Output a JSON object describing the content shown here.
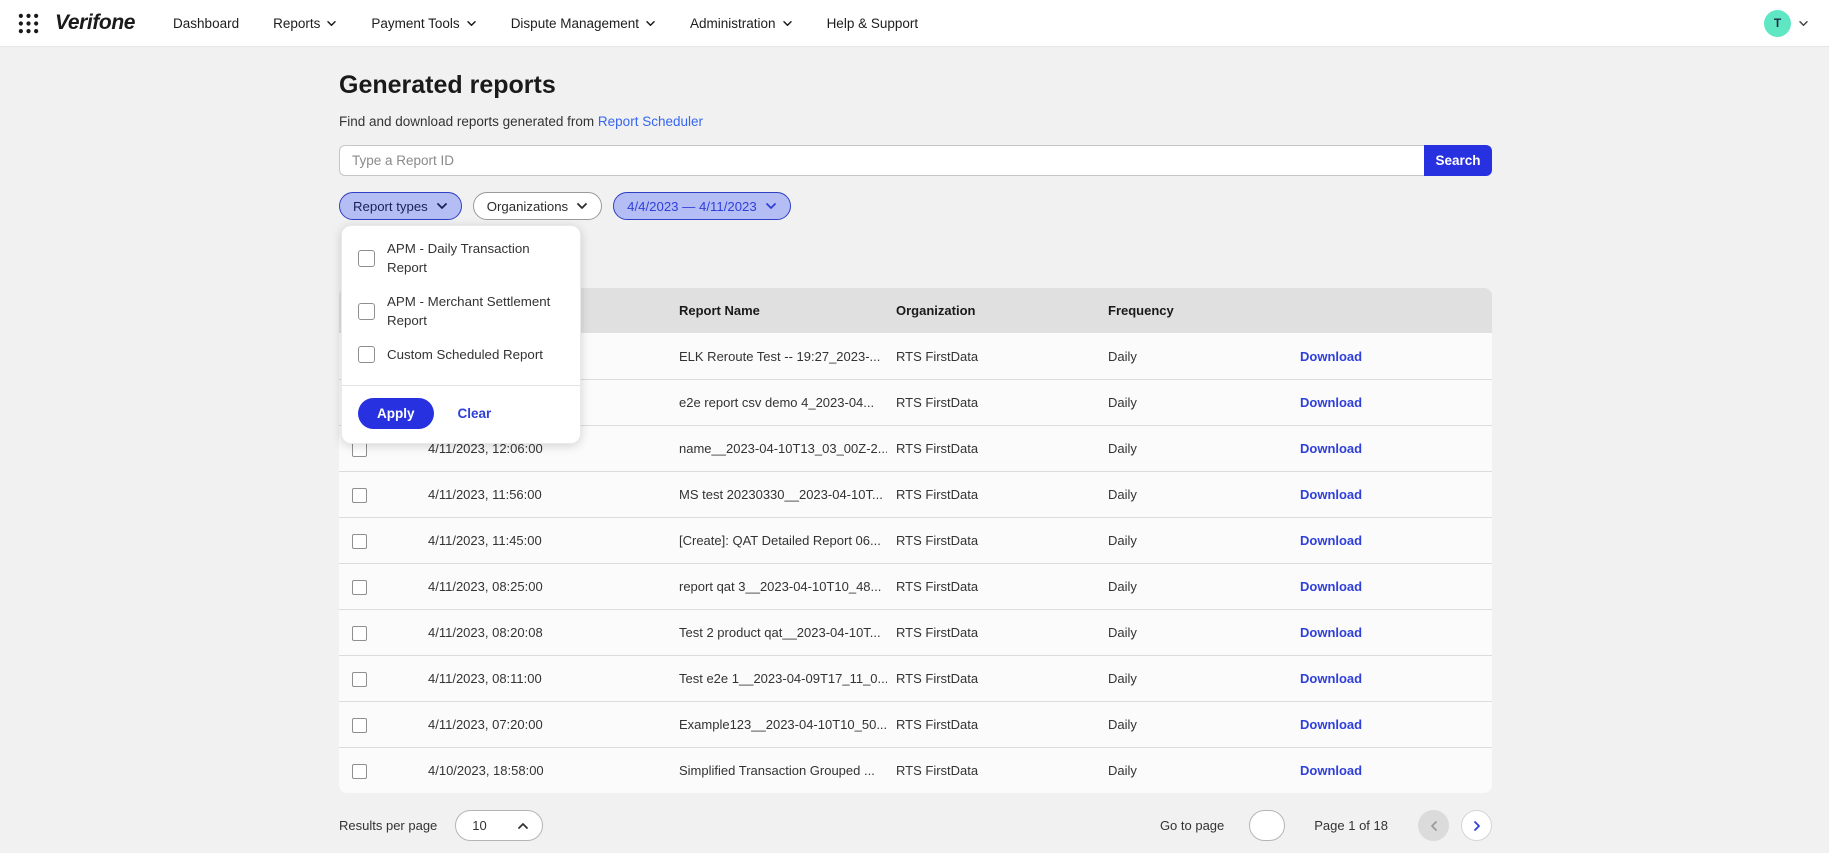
{
  "colors": {
    "accent": "#2731E0",
    "action-blue": "#2F3FD9",
    "link-blue": "#3566EF",
    "chip-bg": "#B5BEF4",
    "chip-border": "#2E3FC2",
    "chip-text": "#17215C",
    "avatar-bg": "#5FE7C3",
    "table-header-bg": "#E0E0E1",
    "page-bg": "#F1F1F2",
    "row-bg": "#FBFBFB",
    "border": "#DCDCDC",
    "text-dark": "#1A1A1A",
    "text-body": "#333333"
  },
  "nav": {
    "brand": "Verifone",
    "items": [
      {
        "label": "Dashboard",
        "has_dropdown": false
      },
      {
        "label": "Reports",
        "has_dropdown": true
      },
      {
        "label": "Payment Tools",
        "has_dropdown": true
      },
      {
        "label": "Dispute Management",
        "has_dropdown": true
      },
      {
        "label": "Administration",
        "has_dropdown": true
      },
      {
        "label": "Help & Support",
        "has_dropdown": false
      }
    ],
    "avatar_initial": "T"
  },
  "header": {
    "title": "Generated reports",
    "subtitle": "Find and download reports generated from",
    "subtitle_link": "Report Scheduler"
  },
  "search": {
    "placeholder": "Type a Report ID",
    "button": "Search"
  },
  "filters": {
    "chips": [
      {
        "label": "Report types",
        "state": "selected"
      },
      {
        "label": "Organizations",
        "state": "neutral"
      },
      {
        "label": "4/4/2023 — 4/11/2023",
        "state": "date"
      }
    ]
  },
  "dropdown": {
    "options": [
      "APM - Daily Transaction Report",
      "APM - Merchant Settlement Report",
      "Custom Scheduled Report"
    ],
    "apply_label": "Apply",
    "clear_label": "Clear"
  },
  "table": {
    "visible_headers": {
      "report_name": "Report Name",
      "organization": "Organization",
      "frequency": "Frequency"
    },
    "rows": [
      {
        "date": "",
        "name": "ELK Reroute Test -- 19:27_2023-...",
        "org": "RTS FirstData",
        "frequency": "Daily",
        "action": "Download"
      },
      {
        "date": "",
        "name": "e2e report csv demo 4_2023-04...",
        "org": "RTS FirstData",
        "frequency": "Daily",
        "action": "Download"
      },
      {
        "date": "4/11/2023, 12:06:00",
        "name": "name__2023-04-10T13_03_00Z-2...",
        "org": "RTS FirstData",
        "frequency": "Daily",
        "action": "Download"
      },
      {
        "date": "4/11/2023, 11:56:00",
        "name": "MS test 20230330__2023-04-10T...",
        "org": "RTS FirstData",
        "frequency": "Daily",
        "action": "Download"
      },
      {
        "date": "4/11/2023, 11:45:00",
        "name": "[Create]: QAT Detailed Report 06...",
        "org": "RTS FirstData",
        "frequency": "Daily",
        "action": "Download"
      },
      {
        "date": "4/11/2023, 08:25:00",
        "name": "report qat 3__2023-04-10T10_48...",
        "org": "RTS FirstData",
        "frequency": "Daily",
        "action": "Download"
      },
      {
        "date": "4/11/2023, 08:20:08",
        "name": "Test 2 product qat__2023-04-10T...",
        "org": "RTS FirstData",
        "frequency": "Daily",
        "action": "Download"
      },
      {
        "date": "4/11/2023, 08:11:00",
        "name": "Test e2e 1__2023-04-09T17_11_0...",
        "org": "RTS FirstData",
        "frequency": "Daily",
        "action": "Download"
      },
      {
        "date": "4/11/2023, 07:20:00",
        "name": "Example123__2023-04-10T10_50...",
        "org": "RTS FirstData",
        "frequency": "Daily",
        "action": "Download"
      },
      {
        "date": "4/10/2023, 18:58:00",
        "name": "Simplified Transaction Grouped ...",
        "org": "RTS FirstData",
        "frequency": "Daily",
        "action": "Download"
      }
    ]
  },
  "pagination": {
    "results_per_page_label": "Results per page",
    "results_per_page_value": "10",
    "go_to_page_label": "Go to page",
    "go_to_page_value": "",
    "page_status": "Page 1 of 18"
  }
}
